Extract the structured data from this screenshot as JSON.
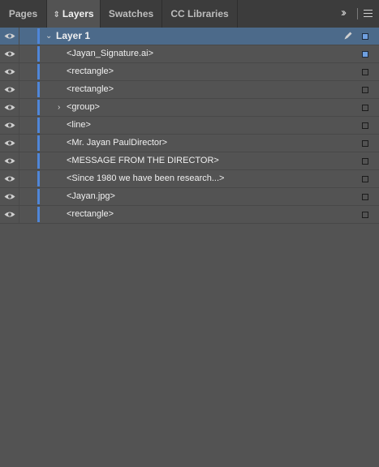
{
  "tabs": [
    {
      "label": "Pages",
      "active": false
    },
    {
      "label": "Layers",
      "active": true
    },
    {
      "label": "Swatches",
      "active": false
    },
    {
      "label": "CC Libraries",
      "active": false
    }
  ],
  "header_icons": {
    "collapse": "double-chevron-right-icon",
    "menu": "panel-menu-icon"
  },
  "colors": {
    "layer_color": "#4f86d8",
    "selected_row": "#4c6a8a",
    "panel_bg": "#535353"
  },
  "layer": {
    "name": "Layer 1",
    "expanded": true,
    "visible": true
  },
  "items": [
    {
      "label": "<Jayan_Signature.ai>",
      "has_children": false,
      "selected_box": true
    },
    {
      "label": "<rectangle>",
      "has_children": false,
      "selected_box": false
    },
    {
      "label": "<rectangle>",
      "has_children": false,
      "selected_box": false
    },
    {
      "label": "<group>",
      "has_children": true,
      "selected_box": false
    },
    {
      "label": "<line>",
      "has_children": false,
      "selected_box": false
    },
    {
      "label": "<Mr. Jayan PaulDirector>",
      "has_children": false,
      "selected_box": false
    },
    {
      "label": "<MESSAGE FROM THE DIRECTOR>",
      "has_children": false,
      "selected_box": false
    },
    {
      "label": "<Since 1980 we have been research...>",
      "has_children": false,
      "selected_box": false
    },
    {
      "label": "<Jayan.jpg>",
      "has_children": false,
      "selected_box": false
    },
    {
      "label": "<rectangle>",
      "has_children": false,
      "selected_box": false
    }
  ]
}
